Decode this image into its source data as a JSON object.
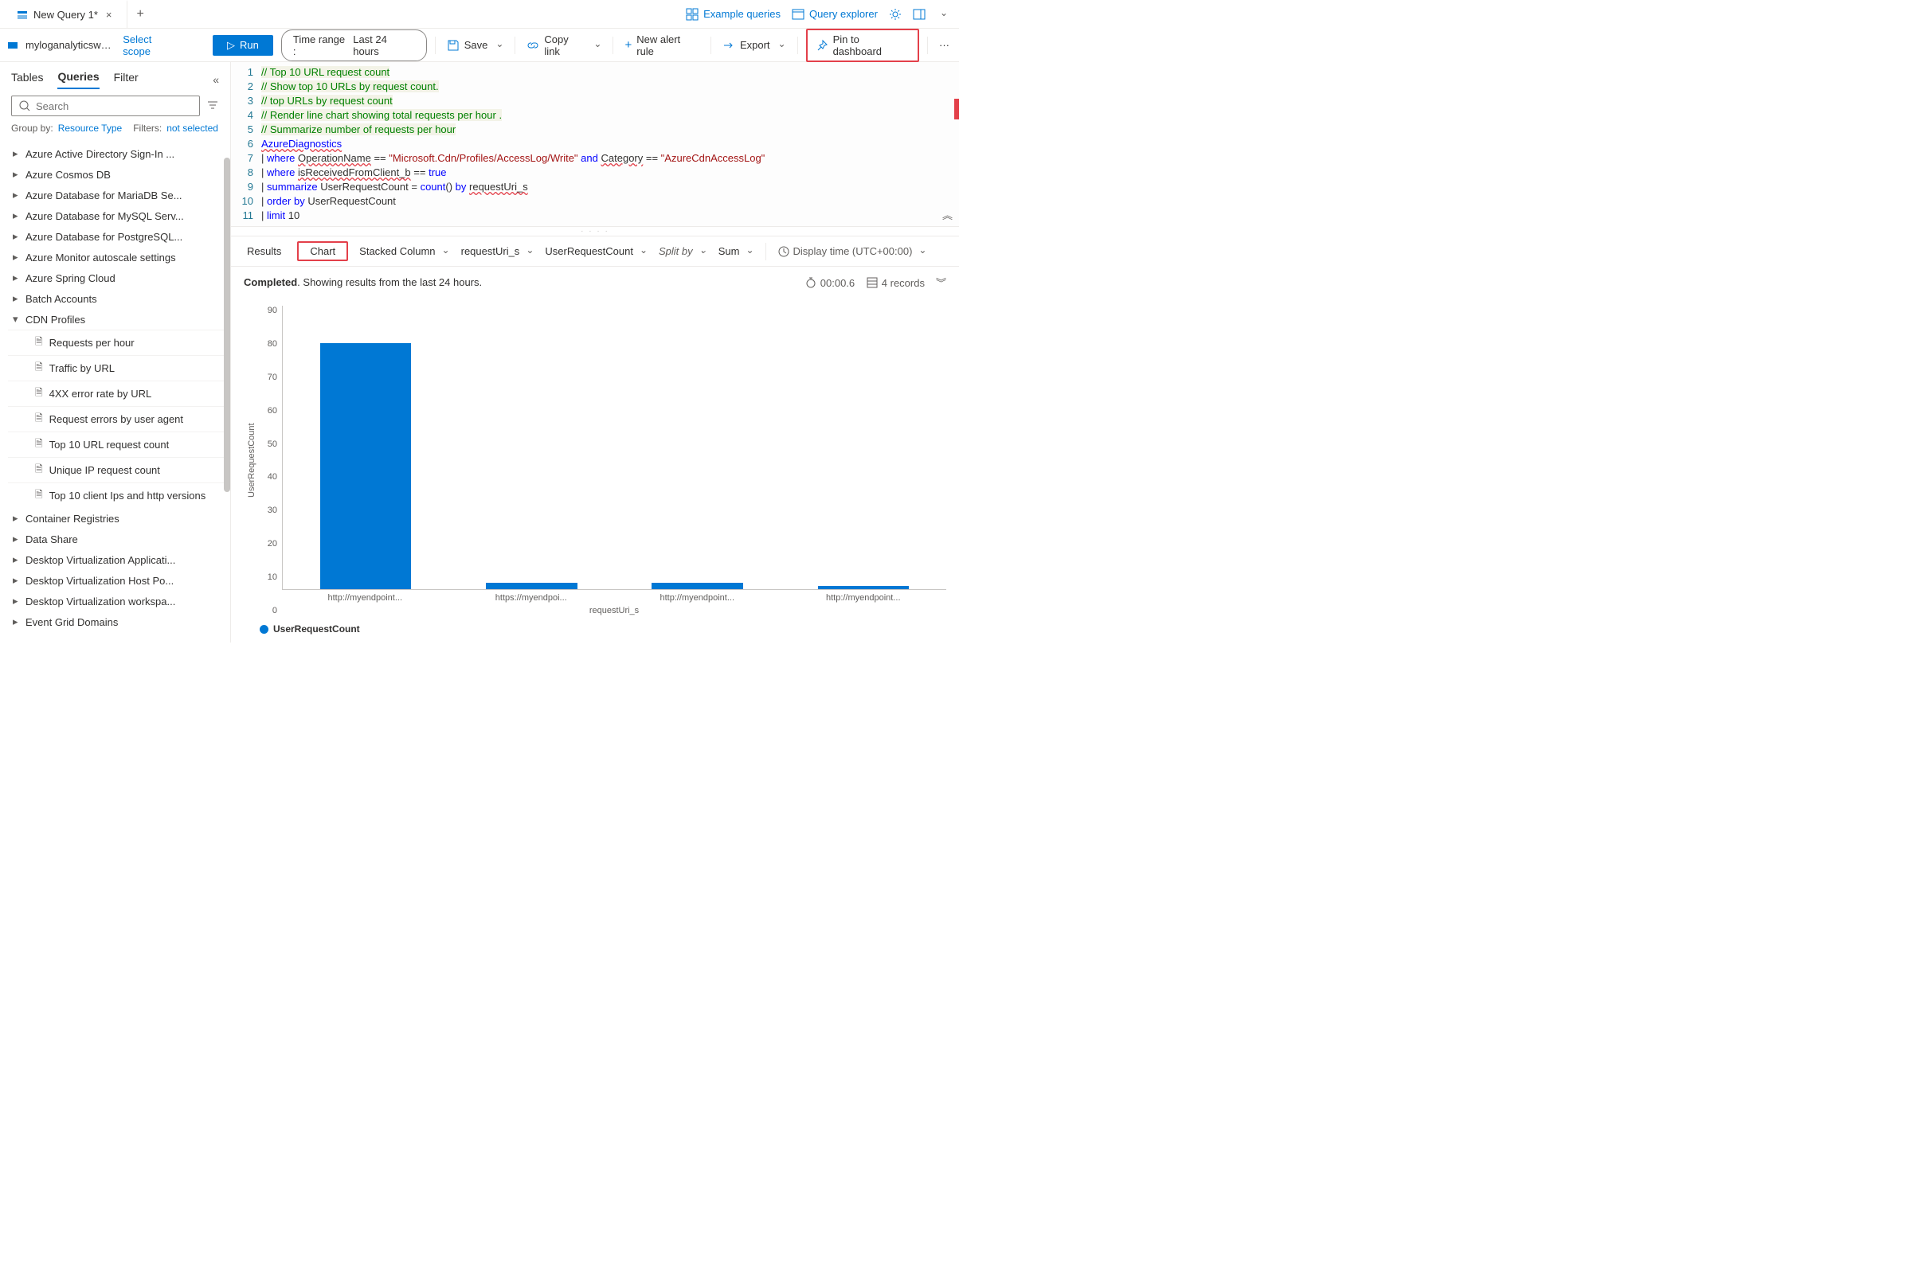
{
  "tabs": {
    "active": "New Query 1*"
  },
  "topright": {
    "example": "Example queries",
    "explorer": "Query explorer"
  },
  "scope": {
    "workspace": "myloganalyticswor...",
    "select": "Select scope"
  },
  "toolbar": {
    "run": "Run",
    "timerange_label": "Time range :",
    "timerange_value": "Last 24 hours",
    "save": "Save",
    "copy": "Copy link",
    "newalert": "New alert rule",
    "export": "Export",
    "pin": "Pin to dashboard"
  },
  "sidebar": {
    "tabs": {
      "tables": "Tables",
      "queries": "Queries",
      "filter": "Filter"
    },
    "search_placeholder": "Search",
    "groupby_label": "Group by:",
    "groupby_value": "Resource Type",
    "filters_label": "Filters:",
    "filters_value": "not selected",
    "nodes": [
      "Azure Active Directory Sign-In ...",
      "Azure Cosmos DB",
      "Azure Database for MariaDB Se...",
      "Azure Database for MySQL Serv...",
      "Azure Database for PostgreSQL...",
      "Azure Monitor autoscale settings",
      "Azure Spring Cloud",
      "Batch Accounts"
    ],
    "expanded": {
      "label": "CDN Profiles",
      "items": [
        "Requests per hour",
        "Traffic by URL",
        "4XX error rate by URL",
        "Request errors by user agent",
        "Top 10 URL request count",
        "Unique IP request count",
        "Top 10 client Ips and http versions"
      ]
    },
    "nodes_after": [
      "Container Registries",
      "Data Share",
      "Desktop Virtualization Applicati...",
      "Desktop Virtualization Host Po...",
      "Desktop Virtualization workspa...",
      "Event Grid Domains"
    ]
  },
  "editor": {
    "lines": [
      {
        "n": 1,
        "html": "<span class='c-comment'>// Top 10 URL request count</span>"
      },
      {
        "n": 2,
        "html": "<span class='c-comment'>// Show top 10 URLs by request count.</span>"
      },
      {
        "n": 3,
        "html": "<span class='c-comment'>// top URLs by request count</span>"
      },
      {
        "n": 4,
        "html": "<span class='c-comment'>// Render line chart showing total requests per hour .</span>"
      },
      {
        "n": 5,
        "html": "<span class='c-comment'>// Summarize number of requests per hour</span>"
      },
      {
        "n": 6,
        "html": "<span class='c-tbl'>AzureDiagnostics</span>"
      },
      {
        "n": 7,
        "html": "| <span class='c-op'>where</span> <span class='c-und'>OperationName</span> == <span class='c-str'>\"Microsoft.Cdn/Profiles/AccessLog/Write\"</span> <span class='c-kw'>and</span> <span class='c-und'>Category</span> == <span class='c-str'>\"AzureCdnAccessLog\"</span>"
      },
      {
        "n": 8,
        "html": "| <span class='c-op'>where</span> <span class='c-und'>isReceivedFromClient_b</span> == <span class='c-bool'>true</span>"
      },
      {
        "n": 9,
        "html": "| <span class='c-op'>summarize</span> UserRequestCount = <span class='c-func'>count</span>() <span class='c-kw'>by</span> <span class='c-und'>requestUri_s</span>"
      },
      {
        "n": 10,
        "html": "| <span class='c-op'>order</span> <span class='c-kw'>by</span> UserRequestCount"
      },
      {
        "n": 11,
        "html": "| <span class='c-op'>limit</span> 10"
      }
    ]
  },
  "charttb": {
    "results": "Results",
    "chart": "Chart",
    "type": "Stacked Column",
    "xfield": "requestUri_s",
    "yfield": "UserRequestCount",
    "splitby": "Split by",
    "agg": "Sum",
    "display_time": "Display time (UTC+00:00)"
  },
  "status": {
    "completed": "Completed",
    "text": ". Showing results from the last 24 hours.",
    "duration": "00:00.6",
    "records": "4 records"
  },
  "chart_data": {
    "type": "bar",
    "title": "",
    "xlabel": "requestUri_s",
    "ylabel": "UserRequestCount",
    "ylim": [
      0,
      90
    ],
    "yticks": [
      0,
      10,
      20,
      30,
      40,
      50,
      60,
      70,
      80,
      90
    ],
    "categories": [
      "http://myendpoint...",
      "https://myendpoi...",
      "http://myendpoint...",
      "http://myendpoint..."
    ],
    "values": [
      78,
      2,
      2,
      1
    ],
    "series_name": "UserRequestCount"
  }
}
